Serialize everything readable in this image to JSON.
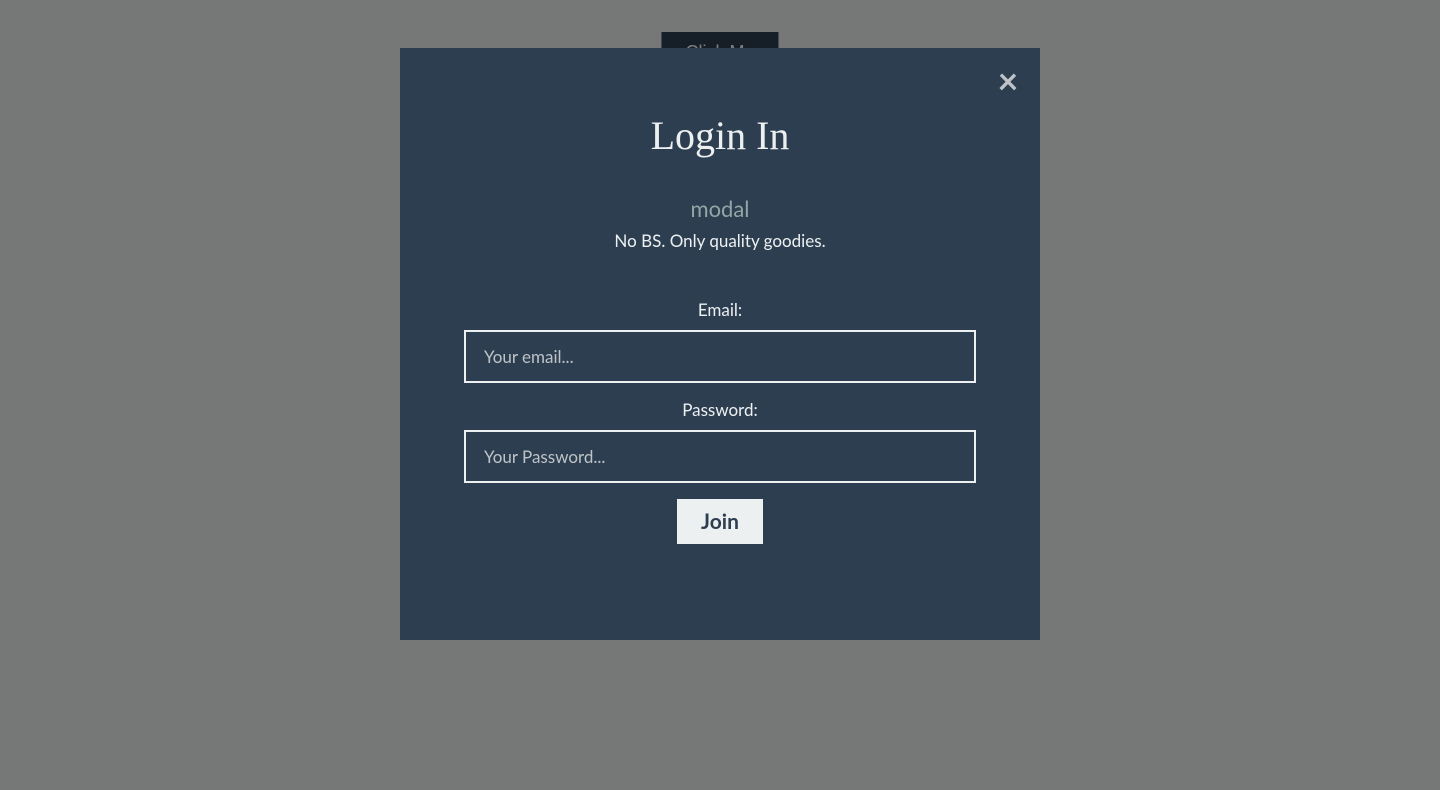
{
  "trigger": {
    "label": "Click Me"
  },
  "modal": {
    "title": "Login In",
    "subtitle": "modal",
    "tagline": "No BS. Only quality goodies.",
    "close_symbol": "×",
    "form": {
      "email_label": "Email:",
      "email_placeholder": "Your email...",
      "password_label": "Password:",
      "password_placeholder": "Your Password...",
      "submit_label": "Join"
    }
  }
}
